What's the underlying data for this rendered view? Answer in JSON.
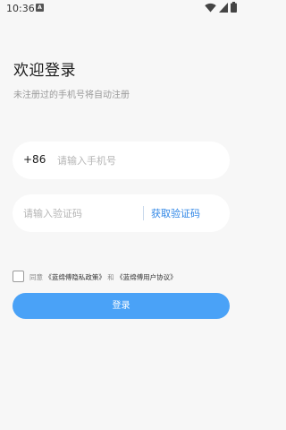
{
  "status_bar": {
    "time": "10:36",
    "notification_badge": "A",
    "icons": [
      "wifi-icon",
      "signal-icon",
      "battery-icon"
    ]
  },
  "header": {
    "title": "欢迎登录",
    "subtitle": "未注册过的手机号将自动注册"
  },
  "phone": {
    "country_code": "+86",
    "value": "",
    "placeholder": "请输入手机号"
  },
  "code": {
    "value": "",
    "placeholder": "请输入验证码",
    "get_code_label": "获取验证码"
  },
  "agreement": {
    "checked": false,
    "prefix": "同意",
    "privacy_link": "《蓝绵傅隐私政策》",
    "conjunction": "和",
    "terms_link": "《蓝绵傅用户协议》"
  },
  "login_button": {
    "label": "登录"
  },
  "colors": {
    "accent": "#4aa2f7",
    "link": "#2f86e6",
    "background": "#f7f7f7"
  }
}
